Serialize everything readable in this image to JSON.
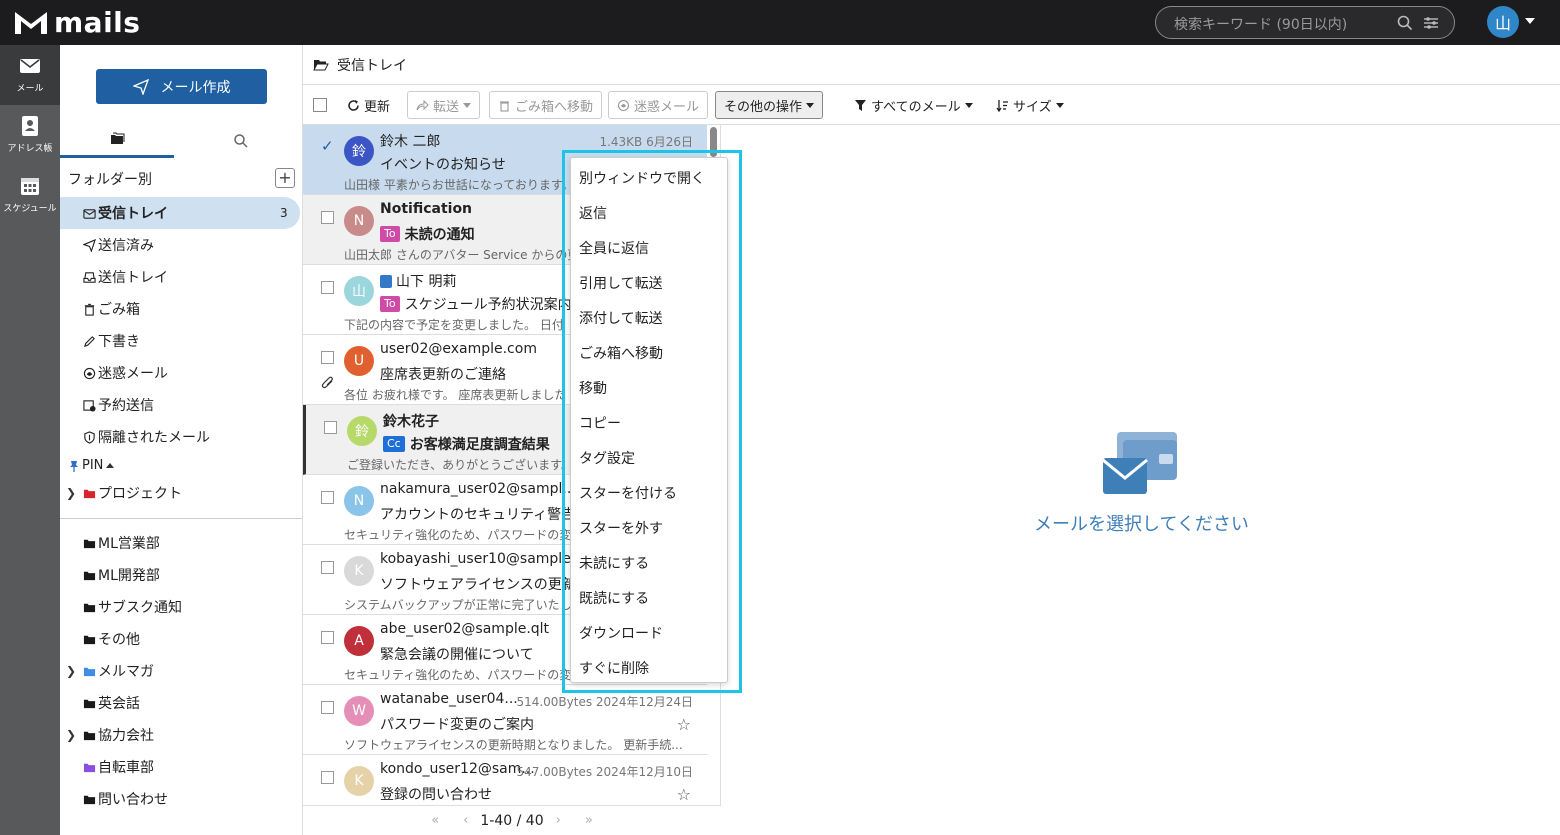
{
  "app": {
    "logo_text": "mails"
  },
  "search": {
    "placeholder": "検索キーワード (90日以内)"
  },
  "user": {
    "avatar": "山"
  },
  "rail": [
    {
      "label": "メール",
      "icon": "mail-icon"
    },
    {
      "label": "アドレス帳",
      "icon": "address-book-icon"
    },
    {
      "label": "スケジュール",
      "icon": "calendar-icon"
    }
  ],
  "sidebar": {
    "compose_label": "メール作成",
    "folders_header": "フォルダー別",
    "pin_label": "PIN",
    "folders": [
      {
        "label": "受信トレイ",
        "count": "3",
        "icon": "inbox-icon"
      },
      {
        "label": "送信済み",
        "icon": "sent-icon"
      },
      {
        "label": "送信トレイ",
        "icon": "outbox-icon"
      },
      {
        "label": "ごみ箱",
        "icon": "trash-icon"
      },
      {
        "label": "下書き",
        "icon": "draft-icon"
      },
      {
        "label": "迷惑メール",
        "icon": "spam-icon"
      },
      {
        "label": "予約送信",
        "icon": "scheduled-icon"
      },
      {
        "label": "隔離されたメール",
        "icon": "quarantine-icon"
      }
    ],
    "pinned": [
      {
        "label": "プロジェクト",
        "color": "#d9232a"
      }
    ],
    "user_folders": [
      {
        "label": "ML営業部",
        "color": "#1a1a1a"
      },
      {
        "label": "ML開発部",
        "color": "#1a1a1a"
      },
      {
        "label": "サブスク通知",
        "color": "#1a1a1a"
      },
      {
        "label": "その他",
        "color": "#1a1a1a"
      },
      {
        "label": "メルマガ",
        "color": "#3f8ee6"
      },
      {
        "label": "英会話",
        "color": "#1a1a1a"
      },
      {
        "label": "協力会社",
        "color": "#1a1a1a"
      },
      {
        "label": "自転車部",
        "color": "#8a4fe0"
      },
      {
        "label": "問い合わせ",
        "color": "#1a1a1a"
      }
    ]
  },
  "path": {
    "title": "受信トレイ"
  },
  "toolbar": {
    "refresh": "更新",
    "forward": "転送",
    "trash": "ごみ箱へ移動",
    "spam": "迷惑メール",
    "more": "その他の操作",
    "filter": "すべてのメール",
    "sort": "サイズ"
  },
  "mails": [
    {
      "from": "鈴木 二郎",
      "avatar": "鈴",
      "color": "#3b56c4",
      "meta": "1.43KB 6月26日",
      "subject": "イベントのお知らせ",
      "preview": "山田様 平素からお世話になっております。",
      "tag": ""
    },
    {
      "from": "Notification",
      "avatar": "N",
      "color": "#c98a8a",
      "meta": "",
      "subject": "未読の通知",
      "preview": "山田太郎 さんのアバター Service からの更",
      "tag": "To"
    },
    {
      "from": "山下 明莉",
      "avatar": "山",
      "color": "#9ad6dc",
      "meta": "",
      "subject": "スケジュール予約状況案内",
      "preview": "下記の内容で予定を変更しました。 日付",
      "tag": "To"
    },
    {
      "from": "user02@example.com",
      "avatar": "U",
      "color": "#e06030",
      "meta": "",
      "subject": "座席表更新のご連絡",
      "preview": "各位 お疲れ様です。 座席表更新しました",
      "tag": ""
    },
    {
      "from": "鈴木花子",
      "avatar": "鈴",
      "color": "#b7d96a",
      "meta": "",
      "subject": "お客様満足度調査結果",
      "preview": "ご登録いただき、ありがとうございます。",
      "tag": "Cc"
    },
    {
      "from": "nakamura_user02@sampl...",
      "avatar": "N",
      "color": "#8ac4e8",
      "meta": "",
      "subject": "アカウントのセキュリティ警告",
      "preview": "セキュリティ強化のため、パスワードの変",
      "tag": ""
    },
    {
      "from": "kobayashi_user10@sample...",
      "avatar": "K",
      "color": "#d9d9d9",
      "meta": "",
      "subject": "ソフトウェアライセンスの更新",
      "preview": "システムバックアップが正常に完了いたし",
      "tag": ""
    },
    {
      "from": "abe_user02@sample.qlt",
      "avatar": "A",
      "color": "#c0303a",
      "meta": "",
      "subject": "緊急会議の開催について",
      "preview": "セキュリティ強化のため、パスワードの変",
      "tag": ""
    },
    {
      "from": "watanabe_user04...",
      "avatar": "W",
      "color": "#e58fb8",
      "meta": "514.00Bytes 2024年12月24日",
      "subject": "パスワード変更のご案内",
      "preview": "ソフトウェアライセンスの更新時期となりました。 更新手続...",
      "tag": ""
    },
    {
      "from": "kondo_user12@sam...",
      "avatar": "K",
      "color": "#e6d2a8",
      "meta": "547.00Bytes 2024年12月10日",
      "subject": "登録の問い合わせ",
      "preview": "",
      "tag": ""
    }
  ],
  "pager": {
    "text": "1-40 / 40"
  },
  "context_menu": [
    "別ウィンドウで開く",
    "返信",
    "全員に返信",
    "引用して転送",
    "添付して転送",
    "ごみ箱へ移動",
    "移動",
    "コピー",
    "タグ設定",
    "スターを付ける",
    "スターを外す",
    "未読にする",
    "既読にする",
    "ダウンロード",
    "すぐに削除"
  ],
  "preview": {
    "empty_text": "メールを選択してください"
  }
}
